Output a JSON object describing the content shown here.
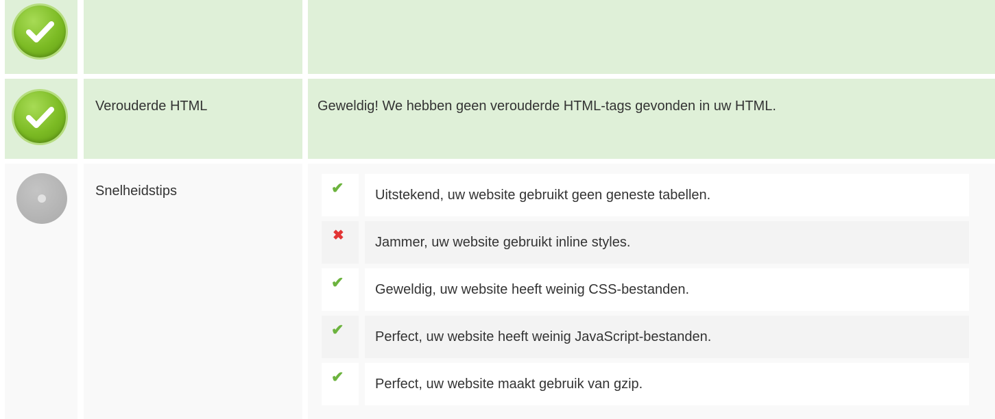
{
  "rows": [
    {
      "status_icon": "check-circle-icon",
      "label": "",
      "content": ""
    },
    {
      "status_icon": "check-circle-icon",
      "label": "Verouderde HTML",
      "content": "Geweldig! We hebben geen verouderde HTML-tags gevonden in uw HTML."
    },
    {
      "status_icon": "neutral-circle-icon",
      "label": "Snelheidstips",
      "tips": [
        {
          "status": "pass",
          "icon": "checkmark-icon",
          "text": "Uitstekend, uw website gebruikt geen geneste tabellen."
        },
        {
          "status": "fail",
          "icon": "cross-icon",
          "text": "Jammer, uw website gebruikt inline styles."
        },
        {
          "status": "pass",
          "icon": "checkmark-icon",
          "text": "Geweldig, uw website heeft weinig CSS-bestanden."
        },
        {
          "status": "pass",
          "icon": "checkmark-icon",
          "text": "Perfect, uw website heeft weinig JavaScript-bestanden."
        },
        {
          "status": "pass",
          "icon": "checkmark-icon",
          "text": "Perfect, uw website maakt gebruik van gzip."
        }
      ]
    }
  ],
  "colors": {
    "pass_row_bg": "#dff0d8",
    "neutral_row_bg": "#f9f9f9",
    "pass_icon": "#7cbb24",
    "neutral_icon": "#aaaaaa",
    "checkmark": "#6cb33e",
    "cross": "#e23434"
  }
}
